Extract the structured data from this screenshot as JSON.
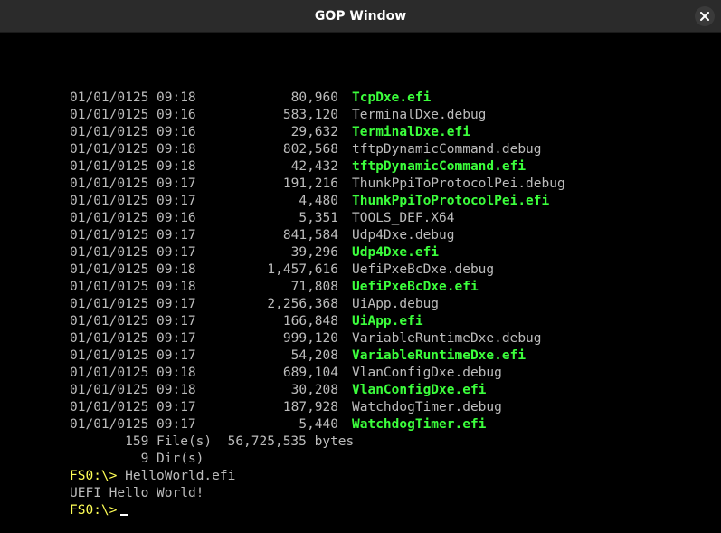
{
  "window": {
    "title": "GOP Window",
    "close_icon": "close-icon"
  },
  "terminal": {
    "files": [
      {
        "date": "01/01/0125",
        "time": "09:18",
        "size": "80,960",
        "name": "TcpDxe.efi",
        "is_efi": true
      },
      {
        "date": "01/01/0125",
        "time": "09:16",
        "size": "583,120",
        "name": "TerminalDxe.debug",
        "is_efi": false
      },
      {
        "date": "01/01/0125",
        "time": "09:16",
        "size": "29,632",
        "name": "TerminalDxe.efi",
        "is_efi": true
      },
      {
        "date": "01/01/0125",
        "time": "09:18",
        "size": "802,568",
        "name": "tftpDynamicCommand.debug",
        "is_efi": false
      },
      {
        "date": "01/01/0125",
        "time": "09:18",
        "size": "42,432",
        "name": "tftpDynamicCommand.efi",
        "is_efi": true
      },
      {
        "date": "01/01/0125",
        "time": "09:17",
        "size": "191,216",
        "name": "ThunkPpiToProtocolPei.debug",
        "is_efi": false
      },
      {
        "date": "01/01/0125",
        "time": "09:17",
        "size": "4,480",
        "name": "ThunkPpiToProtocolPei.efi",
        "is_efi": true
      },
      {
        "date": "01/01/0125",
        "time": "09:16",
        "size": "5,351",
        "name": "TOOLS_DEF.X64",
        "is_efi": false
      },
      {
        "date": "01/01/0125",
        "time": "09:17",
        "size": "841,584",
        "name": "Udp4Dxe.debug",
        "is_efi": false
      },
      {
        "date": "01/01/0125",
        "time": "09:17",
        "size": "39,296",
        "name": "Udp4Dxe.efi",
        "is_efi": true
      },
      {
        "date": "01/01/0125",
        "time": "09:18",
        "size": "1,457,616",
        "name": "UefiPxeBcDxe.debug",
        "is_efi": false
      },
      {
        "date": "01/01/0125",
        "time": "09:18",
        "size": "71,808",
        "name": "UefiPxeBcDxe.efi",
        "is_efi": true
      },
      {
        "date": "01/01/0125",
        "time": "09:17",
        "size": "2,256,368",
        "name": "UiApp.debug",
        "is_efi": false
      },
      {
        "date": "01/01/0125",
        "time": "09:17",
        "size": "166,848",
        "name": "UiApp.efi",
        "is_efi": true
      },
      {
        "date": "01/01/0125",
        "time": "09:17",
        "size": "999,120",
        "name": "VariableRuntimeDxe.debug",
        "is_efi": false
      },
      {
        "date": "01/01/0125",
        "time": "09:17",
        "size": "54,208",
        "name": "VariableRuntimeDxe.efi",
        "is_efi": true
      },
      {
        "date": "01/01/0125",
        "time": "09:18",
        "size": "689,104",
        "name": "VlanConfigDxe.debug",
        "is_efi": false
      },
      {
        "date": "01/01/0125",
        "time": "09:18",
        "size": "30,208",
        "name": "VlanConfigDxe.efi",
        "is_efi": true
      },
      {
        "date": "01/01/0125",
        "time": "09:17",
        "size": "187,928",
        "name": "WatchdogTimer.debug",
        "is_efi": false
      },
      {
        "date": "01/01/0125",
        "time": "09:17",
        "size": "5,440",
        "name": "WatchdogTimer.efi",
        "is_efi": true
      }
    ],
    "summary_files": "       159 File(s)  56,725,535 bytes",
    "summary_dirs": "         9 Dir(s)",
    "prompt_label": "FS0:\\>",
    "command": " HelloWorld.efi",
    "output": "UEFI Hello World!",
    "prompt2_label": "FS0:\\>"
  },
  "colors": {
    "background": "#000000",
    "text": "#bcbcbc",
    "efi_file": "#3cff3c",
    "prompt": "#ffff55",
    "titlebar": "#2b2b2b"
  }
}
